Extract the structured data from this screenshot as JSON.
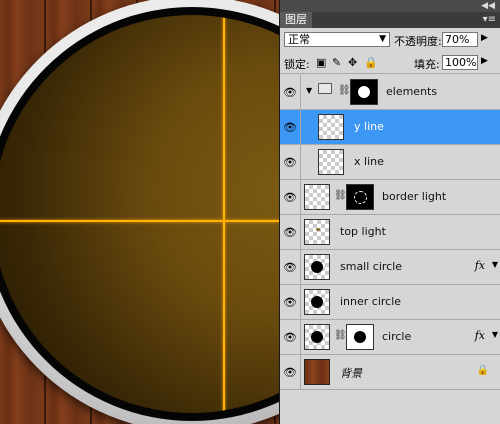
{
  "panel": {
    "tab_label": "图层",
    "collapse_glyph": "◀◀",
    "menu_glyph": "▾≡",
    "blend_mode": "正常",
    "opacity_label": "不透明度:",
    "opacity_value": "70%",
    "lock_label": "锁定:",
    "fill_label": "填充:",
    "fill_value": "100%",
    "lock_icons": [
      "lock-transparent-icon",
      "lock-brush-icon",
      "lock-move-icon",
      "lock-all-icon"
    ]
  },
  "layers": [
    {
      "name": "elements",
      "type": "group",
      "expanded": true
    },
    {
      "name": "y line",
      "selected": true
    },
    {
      "name": "x line"
    },
    {
      "name": "border light",
      "mask": "dotted"
    },
    {
      "name": "top light"
    },
    {
      "name": "small circle",
      "fx": true
    },
    {
      "name": "inner circle"
    },
    {
      "name": "circle",
      "mask": "white",
      "fx": true
    },
    {
      "name": "背景",
      "locked": true
    }
  ],
  "glyphs": {
    "eye": "👁",
    "chain": "⛓",
    "fx": "fx",
    "fx_arrow": "▼",
    "lock": "🔒",
    "twirl": "▼"
  },
  "colors": {
    "selection": "#3d97f5",
    "crosshair": "#ffb400",
    "panel_bg": "#d6d6d6"
  }
}
